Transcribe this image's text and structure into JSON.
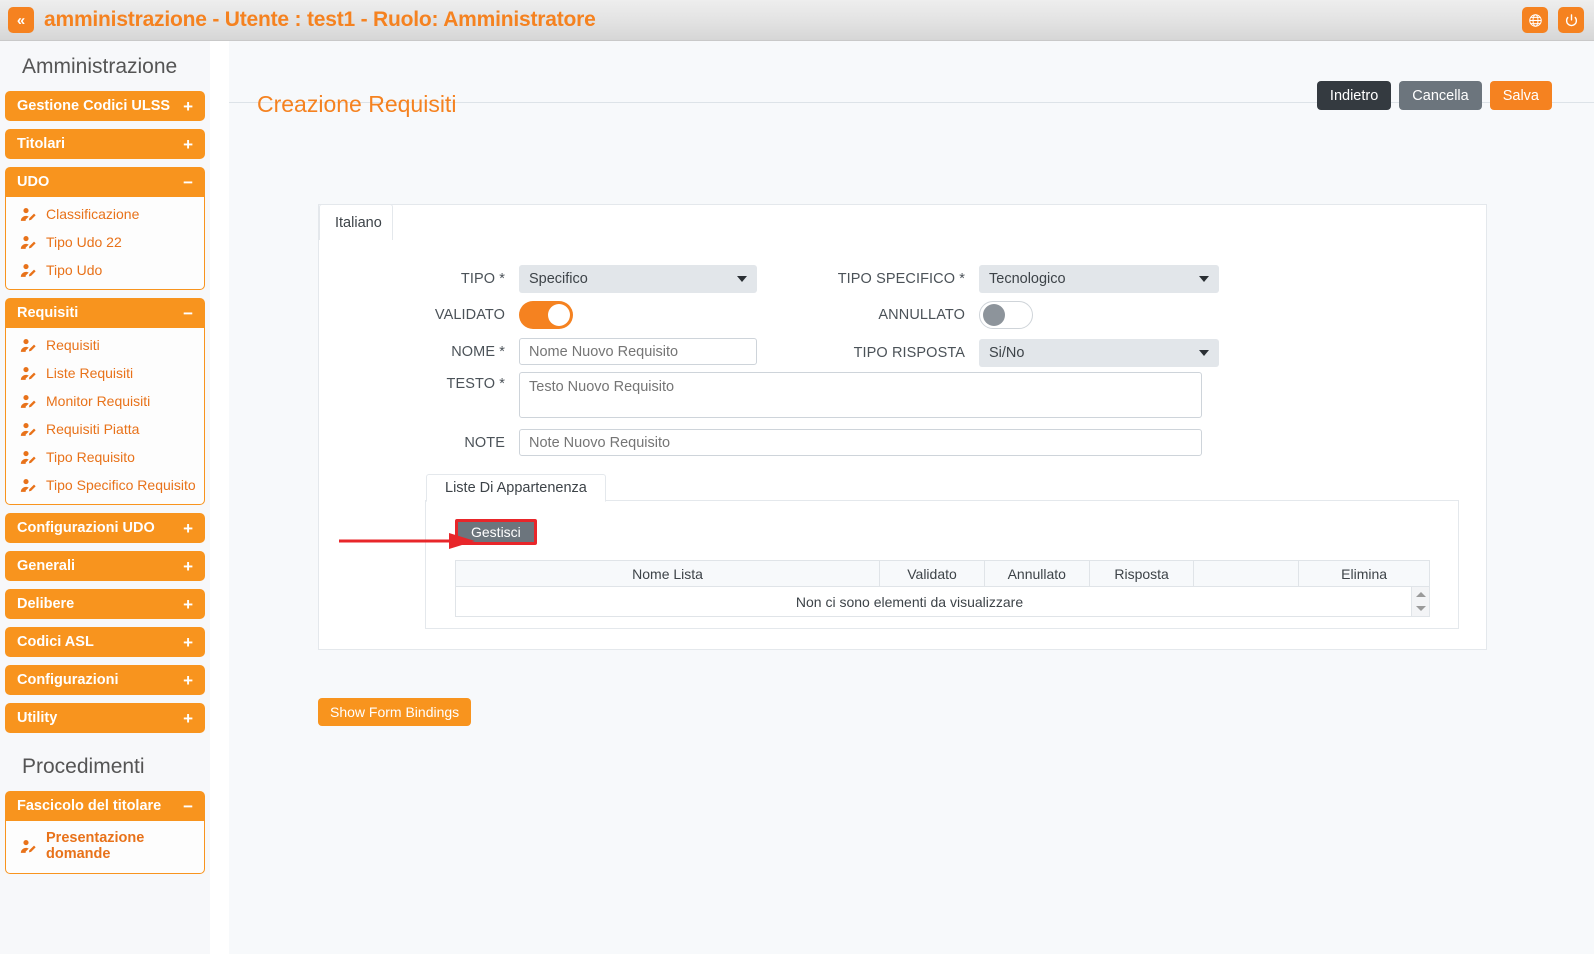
{
  "topbar": {
    "collapse_label": "«",
    "title": "amministrazione - Utente : test1 - Ruolo: Amministratore",
    "globe_icon": "globe-icon",
    "power_icon": "power-icon",
    "accent_orange": "#f58220"
  },
  "sidebar": {
    "heading_admin": "Amministrazione",
    "heading_proc": "Procedimenti",
    "groups": [
      {
        "label": "Gestione Codici ULSS",
        "sign": "+",
        "open": false,
        "items": []
      },
      {
        "label": "Titolari",
        "sign": "+",
        "open": false,
        "items": []
      },
      {
        "label": "UDO",
        "sign": "−",
        "open": true,
        "items": [
          "Classificazione",
          "Tipo Udo 22",
          "Tipo Udo"
        ]
      },
      {
        "label": "Requisiti",
        "sign": "−",
        "open": true,
        "items": [
          "Requisiti",
          "Liste Requisiti",
          "Monitor Requisiti",
          "Requisiti Piatta",
          "Tipo Requisito",
          "Tipo Specifico Requisito"
        ]
      },
      {
        "label": "Configurazioni UDO",
        "sign": "+",
        "open": false,
        "items": []
      },
      {
        "label": "Generali",
        "sign": "+",
        "open": false,
        "items": []
      },
      {
        "label": "Delibere",
        "sign": "+",
        "open": false,
        "items": []
      },
      {
        "label": "Codici ASL",
        "sign": "+",
        "open": false,
        "items": []
      },
      {
        "label": "Configurazioni",
        "sign": "+",
        "open": false,
        "items": []
      },
      {
        "label": "Utility",
        "sign": "+",
        "open": false,
        "items": []
      }
    ],
    "proc_groups": [
      {
        "label": "Fascicolo del titolare",
        "sign": "−",
        "open": true,
        "items": [
          "Presentazione domande"
        ]
      }
    ]
  },
  "page": {
    "title": "Creazione Requisiti",
    "buttons": {
      "back": "Indietro",
      "cancel": "Cancella",
      "save": "Salva"
    },
    "show_bindings": "Show Form Bindings"
  },
  "form": {
    "lang_tab": "Italiano",
    "tipo": {
      "label": "TIPO *",
      "value": "Specifico"
    },
    "tipo_specifico": {
      "label": "TIPO SPECIFICO *",
      "value": "Tecnologico"
    },
    "validato": {
      "label": "VALIDATO",
      "state": "on"
    },
    "annullato": {
      "label": "ANNULLATO",
      "state": "off"
    },
    "nome": {
      "label": "NOME *",
      "value": "",
      "placeholder": "Nome Nuovo Requisito"
    },
    "tipo_risposta": {
      "label": "TIPO RISPOSTA",
      "value": "Si/No"
    },
    "testo": {
      "label": "TESTO *",
      "value": "",
      "placeholder": "Testo Nuovo Requisito"
    },
    "note": {
      "label": "NOTE",
      "value": "",
      "placeholder": "Note Nuovo Requisito"
    }
  },
  "liste": {
    "tab_label": "Liste Di Appartenenza",
    "manage_button": "Gestisci",
    "columns": [
      "Nome Lista",
      "Validato",
      "Annullato",
      "Risposta",
      "",
      "Elimina"
    ],
    "empty_message": "Non ci sono elementi da visualizzare",
    "rows": []
  },
  "annotation": {
    "arrow_color": "#e8262a",
    "highlight_target": "Gestisci"
  }
}
